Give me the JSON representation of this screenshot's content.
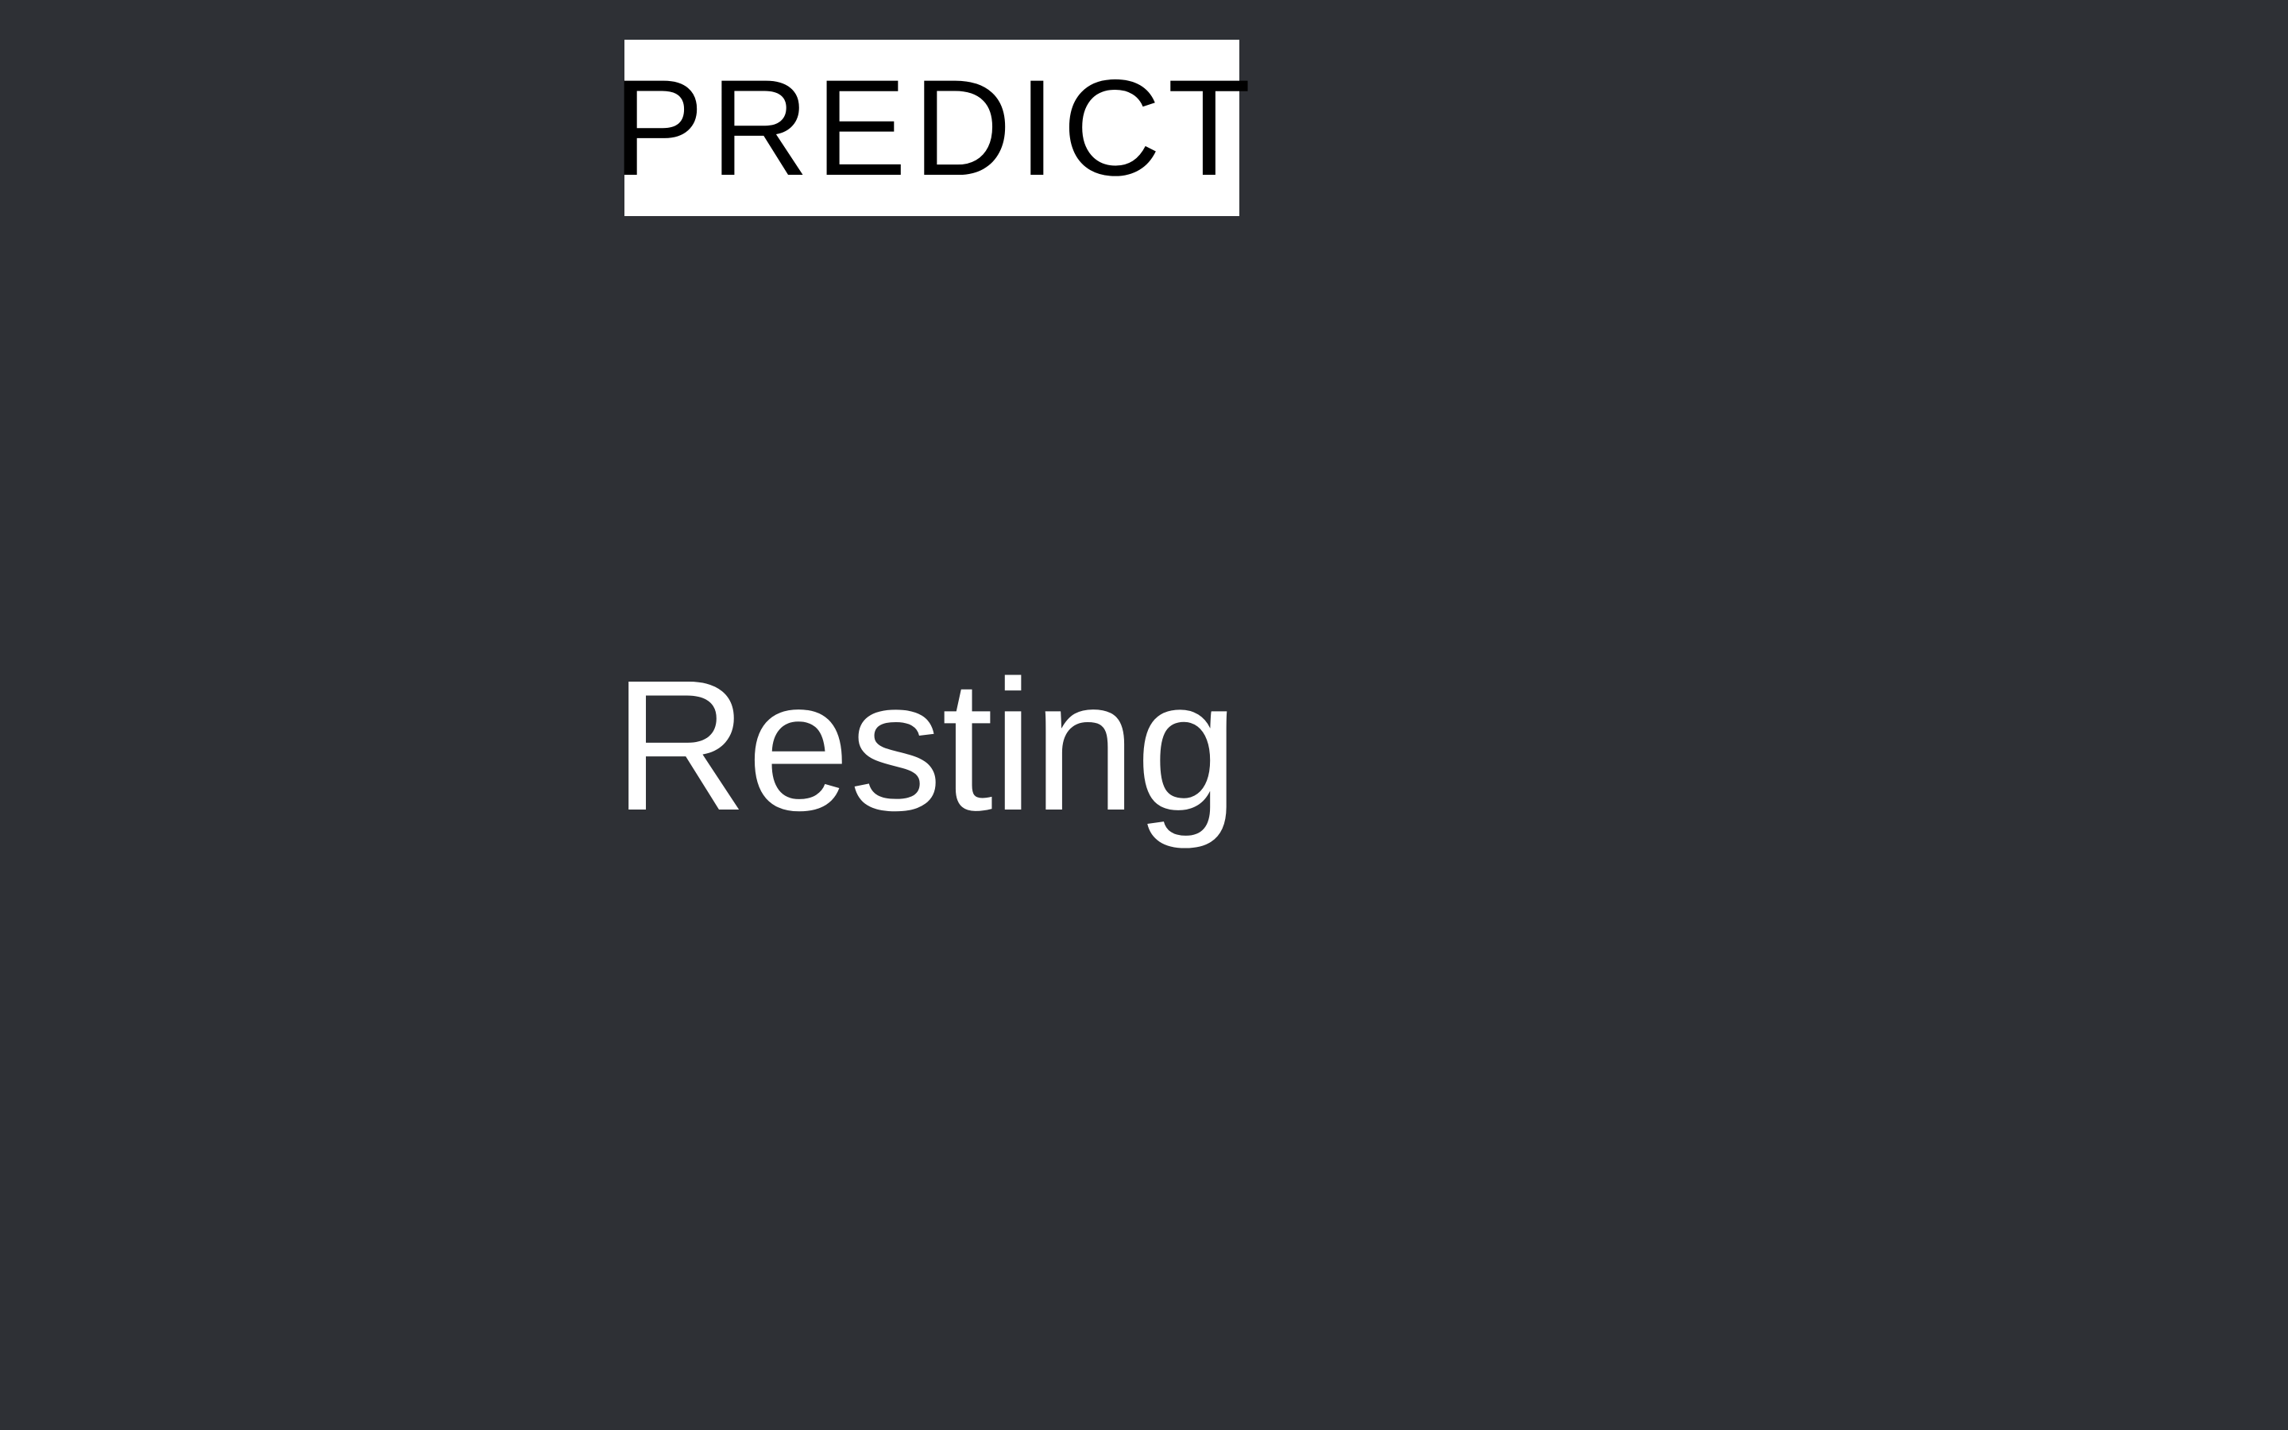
{
  "colors": {
    "background": "#2e3035",
    "button_background": "#ffffff",
    "button_text": "#000000",
    "status_text": "#ffffff"
  },
  "predict_button": {
    "label": "PREDICT"
  },
  "status": {
    "text": "Resting"
  }
}
